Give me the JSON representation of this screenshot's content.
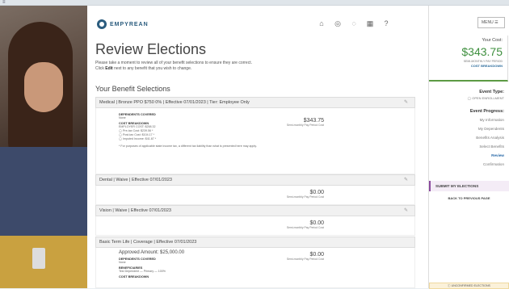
{
  "topbar": {
    "menu_glyph": "≡",
    "toggle_label": "G≡ ☼"
  },
  "brand": {
    "name": "EMPYREAN"
  },
  "header": {
    "icons": [
      "home-icon",
      "globe-icon",
      "chat-icon",
      "calculator-icon",
      "help-icon"
    ],
    "icon_glyphs": [
      "⌂",
      "◎",
      "◌",
      "▦",
      "?"
    ],
    "menu_label": "MENU ☰"
  },
  "page": {
    "title": "Review Elections",
    "intro_line1": "Please take a moment to review all of your benefit selections to ensure they are correct.",
    "intro_line2_prefix": "Click ",
    "intro_line2_bold": "Edit",
    "intro_line2_suffix": " next to any benefit that you wish to change.",
    "selections_heading": "Your Benefit Selections"
  },
  "benefits": {
    "medical": {
      "header": "Medical | Bronze PPO $750 0% | Effective 07/01/2023 | Tier: Employee Only",
      "dependents_label": "DEPENDENTS COVERED",
      "dependents_value": "None",
      "cost_breakdown_label": "COST BREAKDOWN",
      "employer_cost": "EMPLOYER COST: $258.32",
      "pretax": "Pre-tax Cost: $239.56 *",
      "posttax": "Post-tax Cost: $104.17 *",
      "imputed": "Imputed Income: $41.87 *",
      "footnote": "* For purposes of applicable state income tax, a different tax liability than what is presented here may apply.",
      "amount": "$343.75",
      "per": "Semi-monthly Pay Period Cost"
    },
    "dental": {
      "header": "Dental | Waive | Effective 07/01/2023",
      "amount": "$0.00",
      "per": "Semi-monthly Pay Period Cost"
    },
    "vision": {
      "header": "Vision | Waive | Effective 07/01/2023",
      "amount": "$0.00",
      "per": "Semi-monthly Pay Period Cost"
    },
    "life": {
      "header": "Basic Term Life | Coverage | Effective 07/01/2023",
      "approved": "Approved Amount: $25,000.00",
      "dependents_label": "DEPENDENTS COVERED",
      "dependents_value": "None",
      "beneficiaries_label": "BENEFICIARIES",
      "beneficiaries_value": "Test Dependent — Primary — 100%",
      "cost_breakdown_label": "COST BREAKDOWN",
      "amount": "$0.00",
      "per": "Semi-monthly Pay Period Cost"
    }
  },
  "sidebar": {
    "your_cost_label": "Your Cost:",
    "your_cost_value": "$343.75",
    "period_label": "SEMI-MONTHLY PAY PERIOD",
    "cost_breakdown_link": "COST BREAKDOWN",
    "event_type_label": "Event Type:",
    "event_type_value": "◯ OPEN ENROLLMENT",
    "progress_label": "Event Progress:",
    "steps": [
      "My Information",
      "My Dependents",
      "Benefits Analysis",
      "Select Benefits",
      "Review",
      "Confirmation"
    ],
    "submit_label": "SUBMIT MY ELECTIONS",
    "back_label": "BACK TO PREVIOUS PAGE",
    "unconfirmed_label": "ⓘ UNCONFIRMED ELECTIONS"
  },
  "colors": {
    "brand": "#2b5c7e",
    "cost_green": "#3e8f3e",
    "link_blue": "#2a6aa8",
    "submit_accent": "#8b4a9e"
  }
}
